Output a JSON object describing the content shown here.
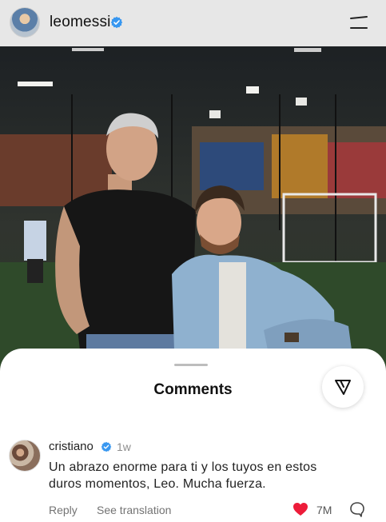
{
  "header": {
    "username": "leomessi",
    "verified": true,
    "menu_icon": "menu-icon"
  },
  "photo": {
    "description_icon": "post-photo"
  },
  "comments_sheet": {
    "title": "Comments",
    "filter_icon": "filter-icon"
  },
  "comment": {
    "username": "cristiano",
    "verified": true,
    "time": "1w",
    "text": "Un abrazo enorme para ti y los tuyos en estos duros momentos, Leo. Mucha fuerza.",
    "reply_label": "Reply",
    "translation_label": "See translation",
    "like_count": "7M",
    "liked": true
  },
  "colors": {
    "verified_blue": "#3897f0",
    "like_red": "#ed1c3a",
    "header_bg": "#e7e7e7"
  }
}
